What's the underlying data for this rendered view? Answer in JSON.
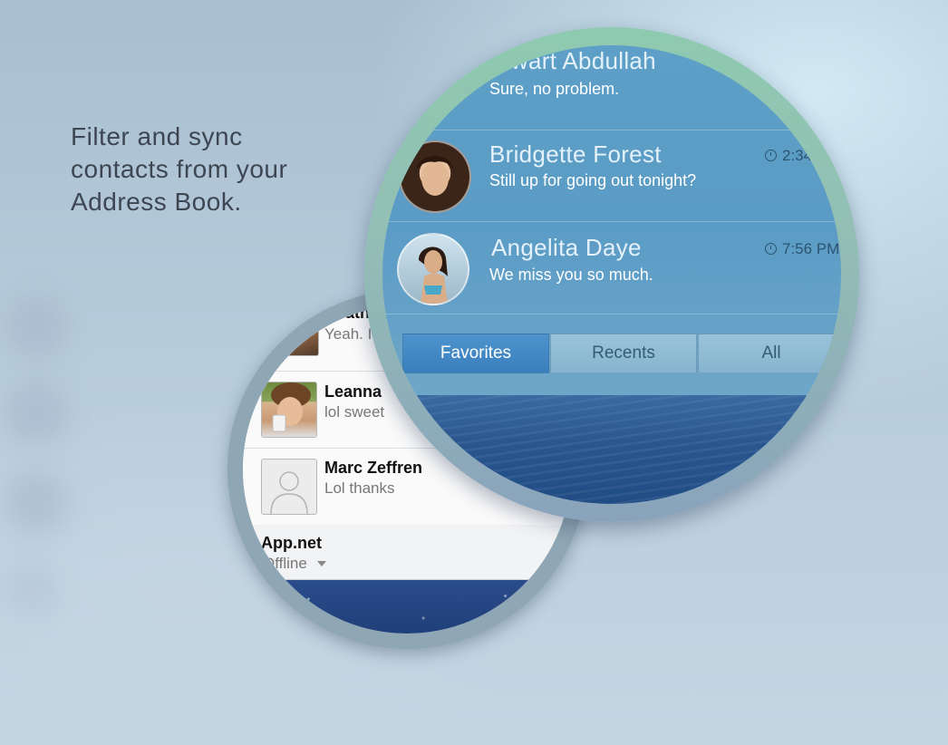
{
  "headline": {
    "line1": "Filter and sync",
    "line2": "contacts from your",
    "line3": "Address Book."
  },
  "small_lens": {
    "contacts": [
      {
        "name": "Heath",
        "message": "Yeah. I",
        "avatar": "person-photo"
      },
      {
        "name": "Leanna",
        "message": "lol sweet",
        "avatar": "person-photo"
      },
      {
        "name": "Marc Zeffren",
        "message": "Lol thanks",
        "avatar": "default-avatar-icon"
      }
    ],
    "service": {
      "name": "App.net",
      "status": "Offline"
    }
  },
  "big_lens": {
    "chats": [
      {
        "name": "Stewart Abdullah",
        "message": "Sure, no problem.",
        "time": ""
      },
      {
        "name": "Bridgette Forest",
        "message": "Still up for going out tonight?",
        "time": "2:34"
      },
      {
        "name": "Angelita Daye",
        "message": "We miss you so much.",
        "time": "7:56 PM"
      }
    ],
    "tabs": {
      "favorites": "Favorites",
      "recents": "Recents",
      "all": "All"
    }
  },
  "colors": {
    "tab_active": "#3f86c4",
    "chat_bg": "#5d9fc6",
    "ring_top": "#8ecab0"
  }
}
